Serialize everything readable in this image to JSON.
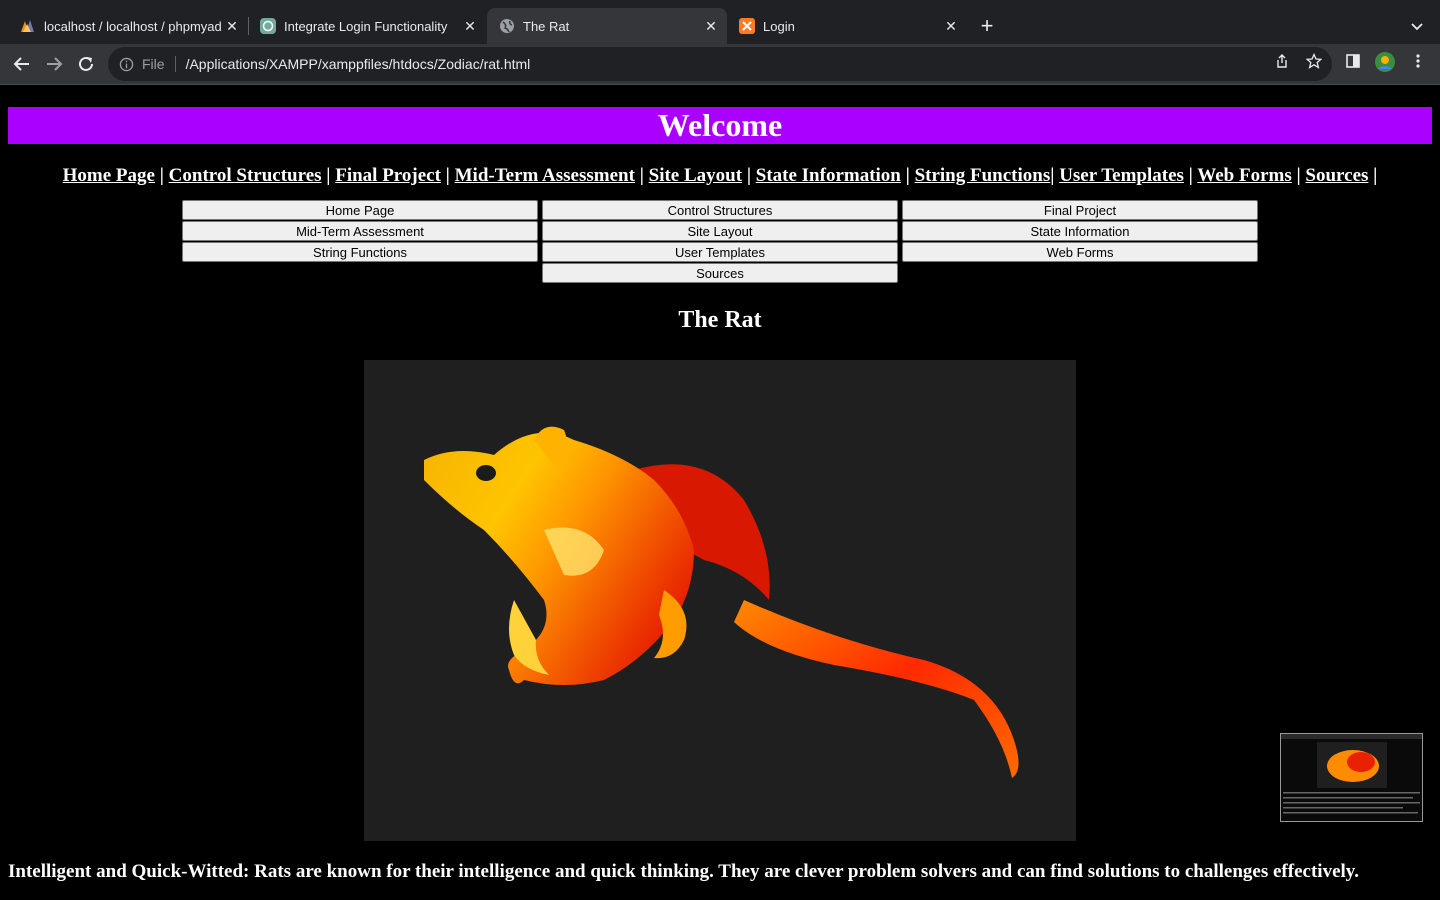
{
  "browser": {
    "tabs": [
      {
        "title": "localhost / localhost / phpmyad",
        "active": false,
        "favicon": "phpmyadmin-icon"
      },
      {
        "title": "Integrate Login Functionality",
        "active": false,
        "favicon": "chatgpt-icon"
      },
      {
        "title": "The Rat",
        "active": true,
        "favicon": "globe-icon"
      },
      {
        "title": "Login",
        "active": false,
        "favicon": "xampp-icon"
      }
    ],
    "address_bar": {
      "scheme_label": "File",
      "url": "/Applications/XAMPP/xamppfiles/htdocs/Zodiac/rat.html"
    }
  },
  "page": {
    "banner": "Welcome",
    "nav_links": [
      "Home Page",
      "Control Structures",
      "Final Project",
      "Mid-Term Assessment",
      "Site Layout",
      "State Information",
      "String Functions",
      "User Templates",
      "Web Forms",
      "Sources"
    ],
    "buttons": [
      "Home Page",
      "Control Structures",
      "Final Project",
      "Mid-Term Assessment",
      "Site Layout",
      "State Information",
      "String Functions",
      "User Templates",
      "Web Forms",
      "Sources"
    ],
    "heading": "The Rat",
    "image_subject": "rat-illustration",
    "description": "Intelligent and Quick-Witted: Rats are known for their intelligence and quick thinking. They are clever problem solvers and can find solutions to challenges effectively."
  },
  "colors": {
    "banner_bg": "#aa00ff",
    "page_bg": "#000000",
    "image_bg": "#1f1f1f"
  }
}
